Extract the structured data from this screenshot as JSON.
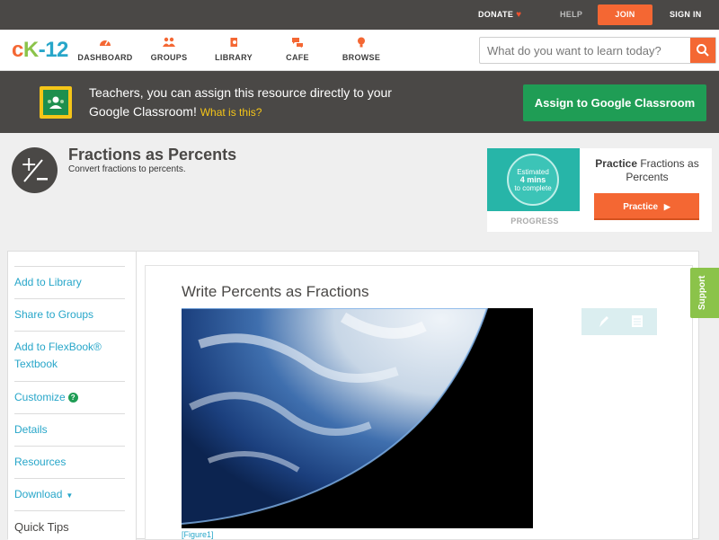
{
  "topbar": {
    "donate": "DONATE",
    "help": "HELP",
    "join": "JOIN",
    "signin": "SIGN IN"
  },
  "nav": {
    "logo_c": "c",
    "logo_k": "K",
    "logo_n": "-12",
    "items": [
      {
        "label": "DASHBOARD",
        "icon": "dashboard-icon"
      },
      {
        "label": "GROUPS",
        "icon": "groups-icon"
      },
      {
        "label": "LIBRARY",
        "icon": "library-icon"
      },
      {
        "label": "CAFE",
        "icon": "cafe-icon"
      },
      {
        "label": "BROWSE",
        "icon": "browse-icon"
      }
    ],
    "search_placeholder": "What do you want to learn today?"
  },
  "banner": {
    "text": "Teachers, you can assign this resource directly to your Google Classroom!",
    "what_link": "What is this?",
    "assign_button": "Assign to Google Classroom"
  },
  "concept": {
    "title": "Fractions as Percents",
    "subtitle": "Convert fractions to percents."
  },
  "practice": {
    "estimated": "Estimated",
    "mins": "4 mins",
    "to_complete": "to complete",
    "progress_label": "PROGRESS",
    "practice_bold": "Practice",
    "practice_rest": " Fractions as Percents",
    "practice_button": "Practice"
  },
  "sidebar": {
    "items": [
      {
        "label": "Add to Library"
      },
      {
        "label": "Share to Groups"
      },
      {
        "label": "Add to FlexBook® Textbook"
      },
      {
        "label": "Customize"
      },
      {
        "label": "Details"
      },
      {
        "label": "Resources"
      },
      {
        "label": "Download"
      },
      {
        "label": "Quick Tips"
      }
    ]
  },
  "article": {
    "title": "Write Percents as Fractions",
    "figure_caption": "[Figure1]"
  },
  "support_tab": "Support",
  "colors": {
    "accent_orange": "#f46733",
    "green": "#1f9d55",
    "teal": "#27a6c9",
    "dark": "#4a4846"
  }
}
